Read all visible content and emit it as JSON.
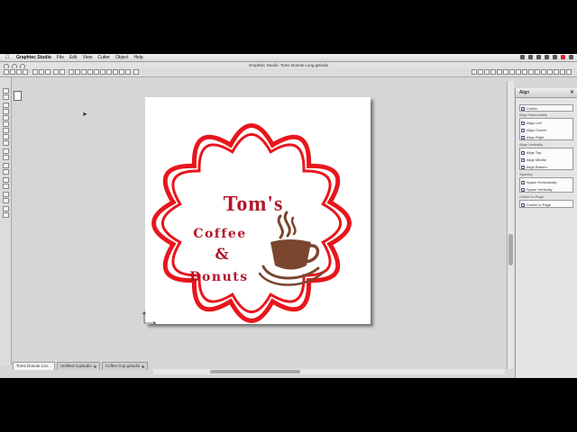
{
  "menubar": {
    "app": "Graphtec Studio",
    "items": [
      "File",
      "Edit",
      "View",
      "Cutter",
      "Object",
      "Help"
    ]
  },
  "window": {
    "title": "Graphtec Studio: Toms Donuts Long.gstudio"
  },
  "artwork": {
    "line1": "Tom's",
    "line2": "Coffee",
    "line3": "&",
    "line4": "Donuts",
    "accent_color": "#e8161c",
    "brand_color": "#b3152b",
    "cup_color": "#7a4630"
  },
  "tabs": [
    {
      "label": "Toms Donuts Lon..."
    },
    {
      "label": "Untitled-3.gstudio"
    },
    {
      "label": "Coffee Cup.gstudio"
    }
  ],
  "panel": {
    "title": "Align",
    "close": "✕",
    "center_label": "Center",
    "horizontal_section": "Align Horizontally",
    "horizontal": [
      "Align Left",
      "Align Center",
      "Align Right"
    ],
    "vertical_section": "Align Vertically",
    "vertical": [
      "Align Top",
      "Align Middle",
      "Align Bottom"
    ],
    "spacing_section": "Spacing",
    "spacing": [
      "Space Horizontally",
      "Space Vertically"
    ],
    "page_section": "Center to Page",
    "page_button": "Center to Page"
  }
}
